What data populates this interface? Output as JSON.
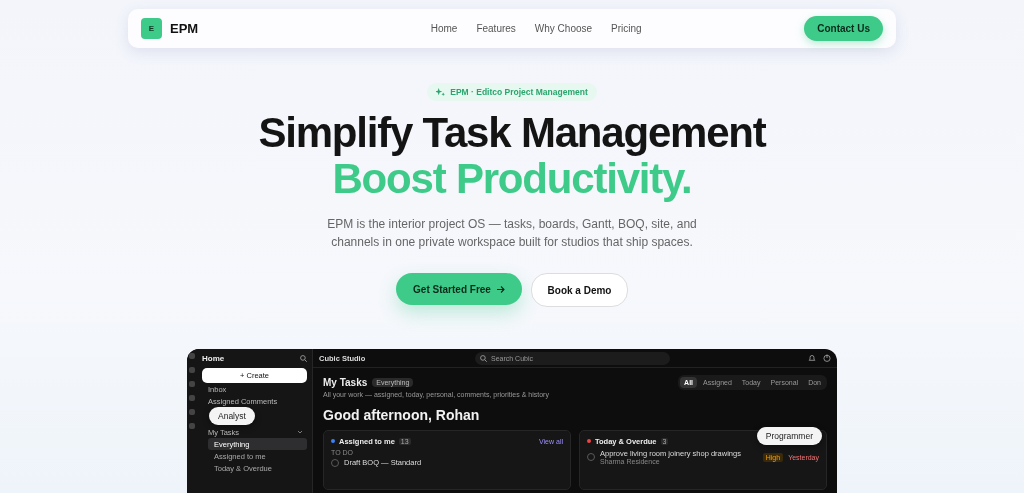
{
  "nav": {
    "logo_letter": "E",
    "brand": "EPM",
    "links": [
      {
        "label": "Home"
      },
      {
        "label": "Features"
      },
      {
        "label": "Why Choose"
      },
      {
        "label": "Pricing"
      }
    ],
    "cta": "Contact Us"
  },
  "hero": {
    "badge": "EPM · Editco Project Management",
    "title_line1": "Simplify Task Management",
    "title_line2": "Boost Productivity.",
    "description": "EPM is the interior project OS — tasks, boards, Gantt, BOQ, site, and channels in one private workspace built for studios that ship spaces.",
    "primary_button": "Get Started Free",
    "secondary_button": "Book a Demo"
  },
  "app_preview": {
    "sidebar": {
      "title": "Home",
      "create": "+ Create",
      "tooltip": "Analyst",
      "items": [
        {
          "label": "Inbox",
          "selected": false
        },
        {
          "label": "Assigned Comments",
          "selected": false
        },
        {
          "label": "My Tasks",
          "selected": false,
          "expanded": true,
          "children": [
            {
              "label": "Everything",
              "selected": true
            },
            {
              "label": "Assigned to me",
              "selected": false
            },
            {
              "label": "Today & Overdue",
              "selected": false
            }
          ]
        }
      ]
    },
    "workspace": "Cubic Studio",
    "search_placeholder": "Search Cubic",
    "page_title": "My Tasks",
    "page_chip": "Everything",
    "subtitle": "All your work — assigned, today, personal, comments, priorities & history",
    "filters": [
      {
        "label": "All",
        "selected": true
      },
      {
        "label": "Assigned",
        "selected": false
      },
      {
        "label": "Today",
        "selected": false
      },
      {
        "label": "Personal",
        "selected": false
      },
      {
        "label": "Don",
        "selected": false
      }
    ],
    "greeting": "Good afternoon, Rohan",
    "cards": [
      {
        "title": "Assigned to me",
        "count": "13",
        "color": "#3b82f6",
        "link": "View all",
        "section": "TO DO",
        "tasks": [
          {
            "title": "Draft BOQ — Standard",
            "checked": false
          }
        ]
      },
      {
        "title": "Today & Overdue",
        "count": "3",
        "color": "#ef4444",
        "tooltip": "Programmer",
        "tasks": [
          {
            "title": "Approve living room joinery shop drawings",
            "checked": false,
            "meta": "Sharma Residence",
            "priority": "High",
            "due": "Yesterday"
          }
        ]
      }
    ]
  }
}
